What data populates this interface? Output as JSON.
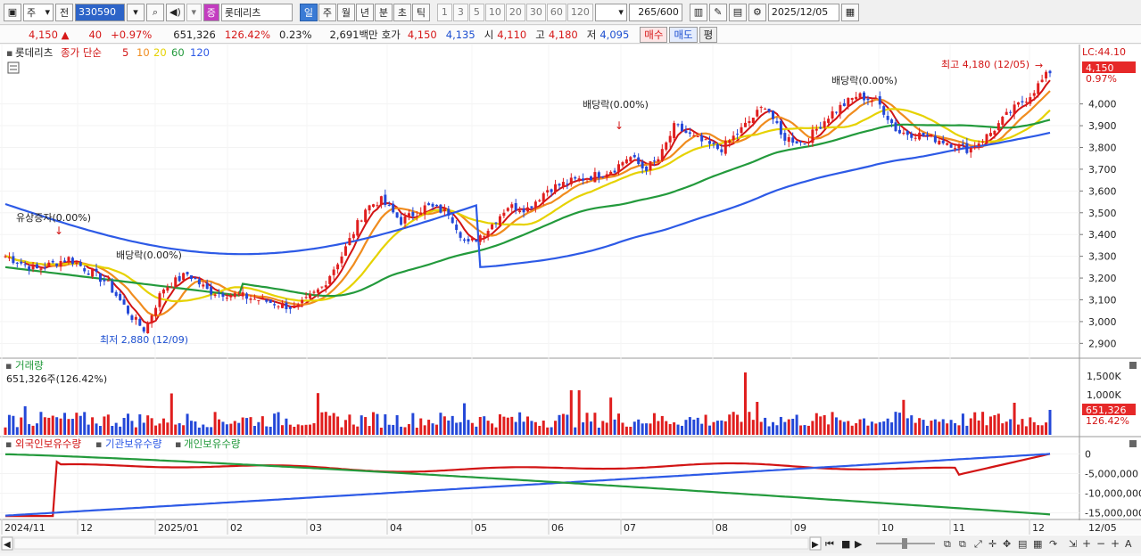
{
  "toolbar": {
    "market_select": "주",
    "prev_label": "전",
    "stock_code": "330590",
    "stock_name": "롯데리츠",
    "stock_tag": "증",
    "periods": [
      "일",
      "주",
      "월",
      "년",
      "분",
      "초",
      "틱"
    ],
    "period_active": "일",
    "minute_options": [
      "1",
      "3",
      "5",
      "10",
      "20",
      "30",
      "60",
      "120"
    ],
    "count": "265",
    "count_total": "/600",
    "date": "2025/12/05"
  },
  "quote": {
    "price": "4,150",
    "arrow": "▲",
    "change": "40",
    "change_pct": "+0.97%",
    "volume": "651,326",
    "volume_ratio": "126.42%",
    "turnover_pct": "0.23%",
    "amount": "2,691백만",
    "bid_label": "호가",
    "bid1": "4,150",
    "bid2": "4,135",
    "open_label": "시",
    "open": "4,110",
    "high_label": "고",
    "high": "4,180",
    "low_label": "저",
    "low": "4,095",
    "buy_label": "매수",
    "sell_label": "매도",
    "eval_label": "평"
  },
  "price_panel": {
    "legend_name": "롯데리츠",
    "legend_close": "종가 단순",
    "ma_labels": [
      "5",
      "10",
      "20",
      "60",
      "120"
    ],
    "ma_colors": [
      "#d21414",
      "#f08c1e",
      "#e6d200",
      "#239a3c",
      "#2d5ae6"
    ],
    "ticks": [
      "4,000",
      "3,900",
      "3,800",
      "3,700",
      "3,600",
      "3,500",
      "3,400",
      "3,300",
      "3,200",
      "3,100",
      "3,000",
      "2,900"
    ],
    "lc_label": "LC:44.10",
    "price_box": "4,150",
    "price_pct": "0.97%",
    "annotations": {
      "rights_issue": "유상증자(0.00%)",
      "dividend1": "배당락(0.00%)",
      "dividend2": "배당락(0.00%)",
      "dividend3": "배당락(0.00%)",
      "low": "최저 2,880 (12/09)",
      "high": "최고 4,180 (12/05)"
    }
  },
  "volume_panel": {
    "title": "거래량",
    "info": "651,326주(126.42%)",
    "ticks": [
      "1,500K",
      "1,000K"
    ],
    "box": "651,326",
    "pct": "126.42%"
  },
  "holdings_panel": {
    "legends": [
      "외국인보유수량",
      "기관보유수량",
      "개인보유수량"
    ],
    "colors": [
      "#d21414",
      "#2d5ae6",
      "#239a3c"
    ],
    "ticks": [
      "0",
      "-5,000,000",
      "-10,000,000",
      "-15,000,000"
    ]
  },
  "x_axis": {
    "labels": [
      "2024/11",
      "12",
      "2025/01",
      "02",
      "03",
      "04",
      "05",
      "06",
      "07",
      "08",
      "09",
      "10",
      "11",
      "12"
    ],
    "right_label": "12/05"
  }
}
